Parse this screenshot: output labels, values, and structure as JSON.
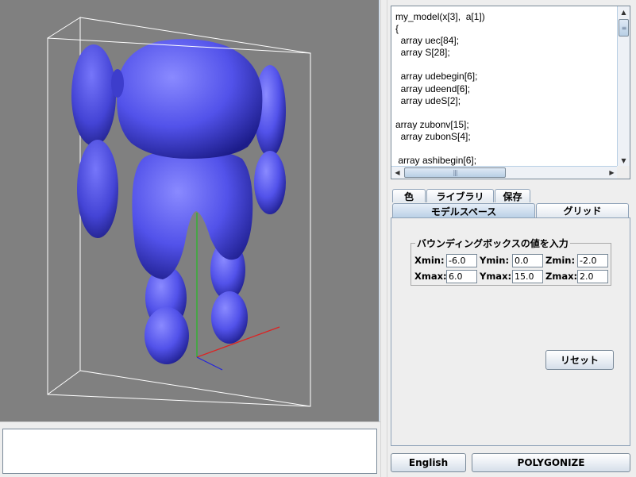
{
  "code_editor": {
    "lines": [
      "my_model(x[3],  a[1])",
      "{",
      "  array uec[84];",
      "  array S[28];",
      "",
      "  array udebegin[6];",
      "  array udeend[6];",
      "  array udeS[2];",
      "",
      "array zubonv[15];",
      "  array zubonS[4];",
      "",
      " array ashibegin[6];"
    ]
  },
  "tabs_row1": [
    "色",
    "ライブラリ",
    "保存"
  ],
  "tabs_row2": [
    "モデルスペース",
    "グリッド"
  ],
  "selected_tab": "モデルスペース",
  "bounding_box": {
    "title": "バウンディングボックスの値を入力",
    "xmin_label": "Xmin:",
    "xmin": "-6.0",
    "ymin_label": "Ymin:",
    "ymin": "0.0",
    "zmin_label": "Zmin:",
    "zmin": "-2.0",
    "xmax_label": "Xmax:",
    "xmax": "6.0",
    "ymax_label": "Ymax:",
    "ymax": "15.0",
    "zmax_label": "Zmax:",
    "zmax": "2.0"
  },
  "reset_label": "リセット",
  "english_label": "English",
  "polygonize_label": "POLYGONIZE",
  "colors": {
    "viewport_bg": "#808080",
    "model": "#5555ee",
    "axis_x": "#dd2222",
    "axis_y": "#22bb22",
    "axis_z": "#2222dd",
    "accent": "#b8cfe5"
  },
  "icons": {
    "scroll_up": "triangle-up",
    "scroll_down": "triangle-down",
    "scroll_left": "triangle-left",
    "scroll_right": "triangle-right"
  }
}
